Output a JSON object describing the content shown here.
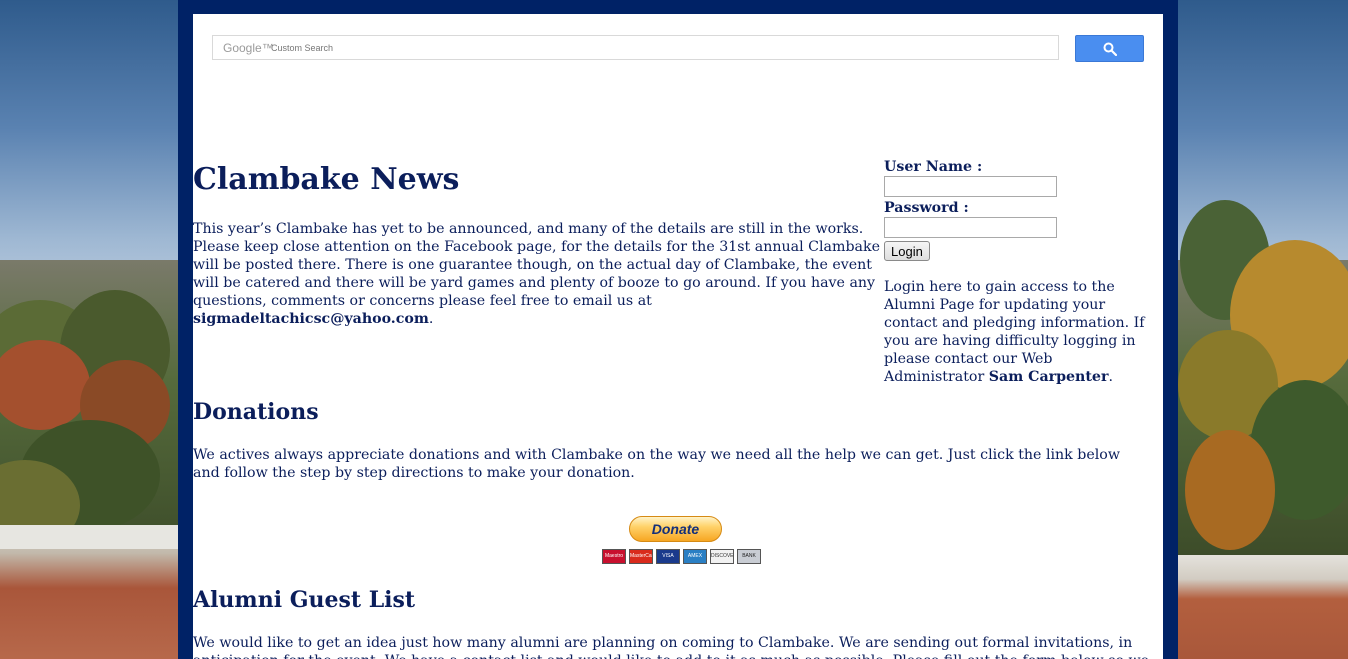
{
  "search": {
    "logo_text": "Google™",
    "placeholder": "Custom Search",
    "button_icon": "search-icon"
  },
  "news": {
    "title": "Clambake News",
    "body": "This year’s Clambake has yet to be announced, and many of the details are still in the works. Please keep close attention on the Facebook page, for the details for the 31st annual Clambake will be posted there. There is one guarantee though, on the actual day of Clambake, the event will be catered and there will be yard games and plenty of booze to go around. If you have any questions, comments or concerns please feel free to email us at ",
    "email": "sigmadeltachicsc@yahoo.com",
    "end": "."
  },
  "login": {
    "username_label": "User Name :",
    "password_label": "Password :",
    "button": "Login",
    "info": "Login here to gain access to the Alumni Page for updating your contact and pledging information. If you are having difficulty logging in please contact our Web Administrator ",
    "admin": "Sam Carpenter",
    "info_end": "."
  },
  "donations": {
    "title": "Donations",
    "body": "We actives always appreciate donations and with Clambake on the way we need all the help we can get. Just click the link below and follow the step by step directions to make your donation.",
    "button": "Donate",
    "cards": [
      "Maestro",
      "MasterCard",
      "VISA",
      "AMEX",
      "DISCOVER",
      "BANK"
    ]
  },
  "alumni": {
    "title": "Alumni Guest List",
    "body": "We would like to get an idea just how many alumni are planning on coming to Clambake. We are sending out formal invitations, in anticipation for the event. We have a contact list and would like to add to it as much as possible. Please fill out the form below so we can ensure a spot for you this year."
  },
  "colors": {
    "frame": "#002266",
    "heading": "#0b1e5b",
    "search_button": "#4a8ef0"
  }
}
